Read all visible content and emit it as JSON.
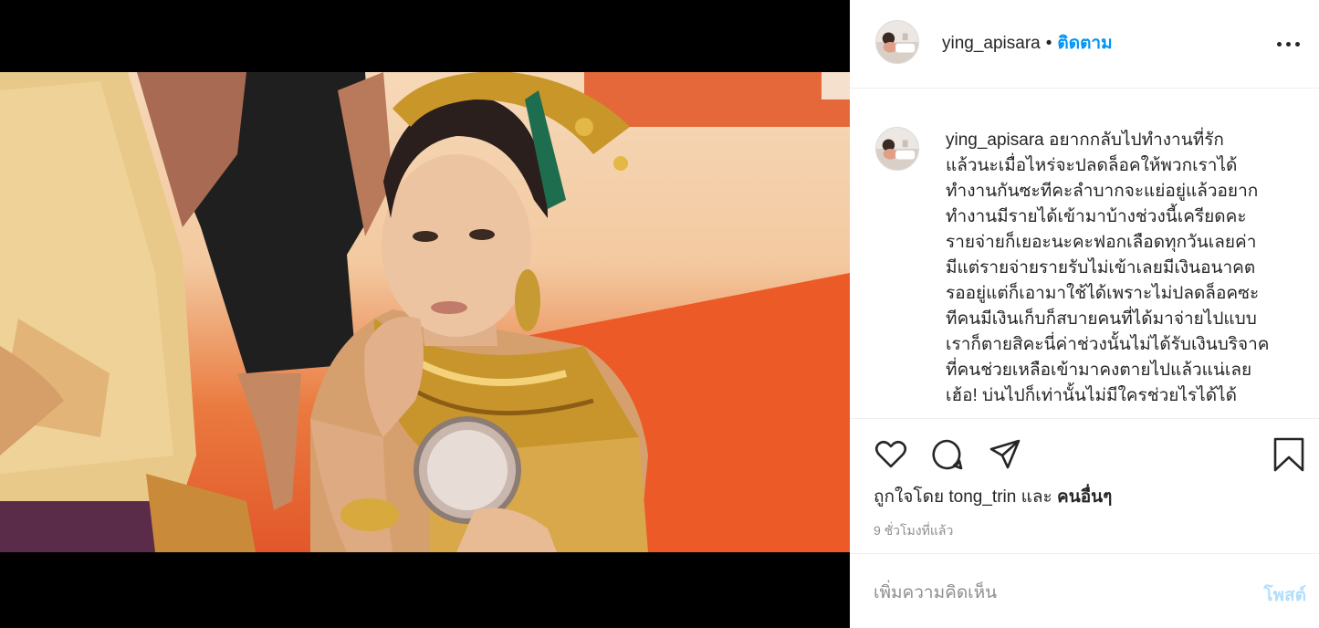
{
  "post": {
    "username": "ying_apisara",
    "separator": "•",
    "follow_label": "ติดตาม",
    "more_icon": "more-horizontal-icon"
  },
  "caption": {
    "username": "ying_apisara",
    "text": "อยากกลับไปทำงานที่รักแล้วนะเมื่อไหร่จะปลดล็อคให้พวกเราได้ทำงานกันซะทีคะลำบากจะแย่อยู่แล้วอยากทำงานมีรายได้เข้ามาบ้างช่วงนี้เครียดคะรายจ่ายก็เยอะนะคะฟอกเลือดทุกวันเลยค่ามีแต่รายจ่ายรายรับไม่เข้าเลยมีเงินอนาคตรออยู่แต่ก็เอามาใช้ได้เพราะไม่ปลดล็อคซะทีคนมีเงินเก็บก็สบายคนที่ได้มาจ่ายไปแบบเราก็ตายสิคะนี่ค่าช่วงนั้นไม่ได้รับเงินบริจาคที่คนช่วยเหลือเข้ามาคงตายไปแล้วแน่เลยเฮ้อ! บ่นไปก็เท่านั้นไม่มีใครช่วยไรได้ได้"
  },
  "caption_lines": [
    "อยากกลับไปทำงานที่รัก",
    "แล้วนะเมื่อไหร่จะปลดล็อคให้พวกเราได้",
    "ทำงานกันซะทีคะลำบากจะแย่อยู่แล้วอยาก",
    "ทำงานมีรายได้เข้ามาบ้างช่วงนี้เครียดคะ",
    "รายจ่ายก็เยอะนะคะฟอกเลือดทุกวันเลยค่า",
    "มีแต่รายจ่ายรายรับไม่เข้าเลยมีเงินอนาคต",
    "รออยู่แต่ก็เอามาใช้ได้เพราะไม่ปลดล็อคซะ",
    "ทีคนมีเงินเก็บก็สบายคนที่ได้มาจ่ายไปแบบ",
    "เราก็ตายสิคะนี่ค่าช่วงนั้นไม่ได้รับเงินบริจาค",
    "ที่คนช่วยเหลือเข้ามาคงตายไปแล้วแน่เลย",
    "เฮ้อ! บ่นไปก็เท่านั้นไม่มีใครช่วยไรได้ได้"
  ],
  "actions": {
    "like_icon": "heart-icon",
    "comment_icon": "comment-bubble-icon",
    "share_icon": "paper-plane-icon",
    "save_icon": "bookmark-icon"
  },
  "likes": {
    "prefix": "ถูกใจโดย",
    "liker": "tong_trin",
    "conjunction": "และ",
    "others": "คนอื่นๆ"
  },
  "timestamp": "9 ชั่วโมงที่แล้ว",
  "comment_box": {
    "placeholder": "เพิ่มความคิดเห็น",
    "post_label": "โพสต์"
  },
  "colors": {
    "link_blue": "#0095f6",
    "post_disabled": "#b2dffc",
    "text": "#262626",
    "muted": "#8e8e8e"
  }
}
